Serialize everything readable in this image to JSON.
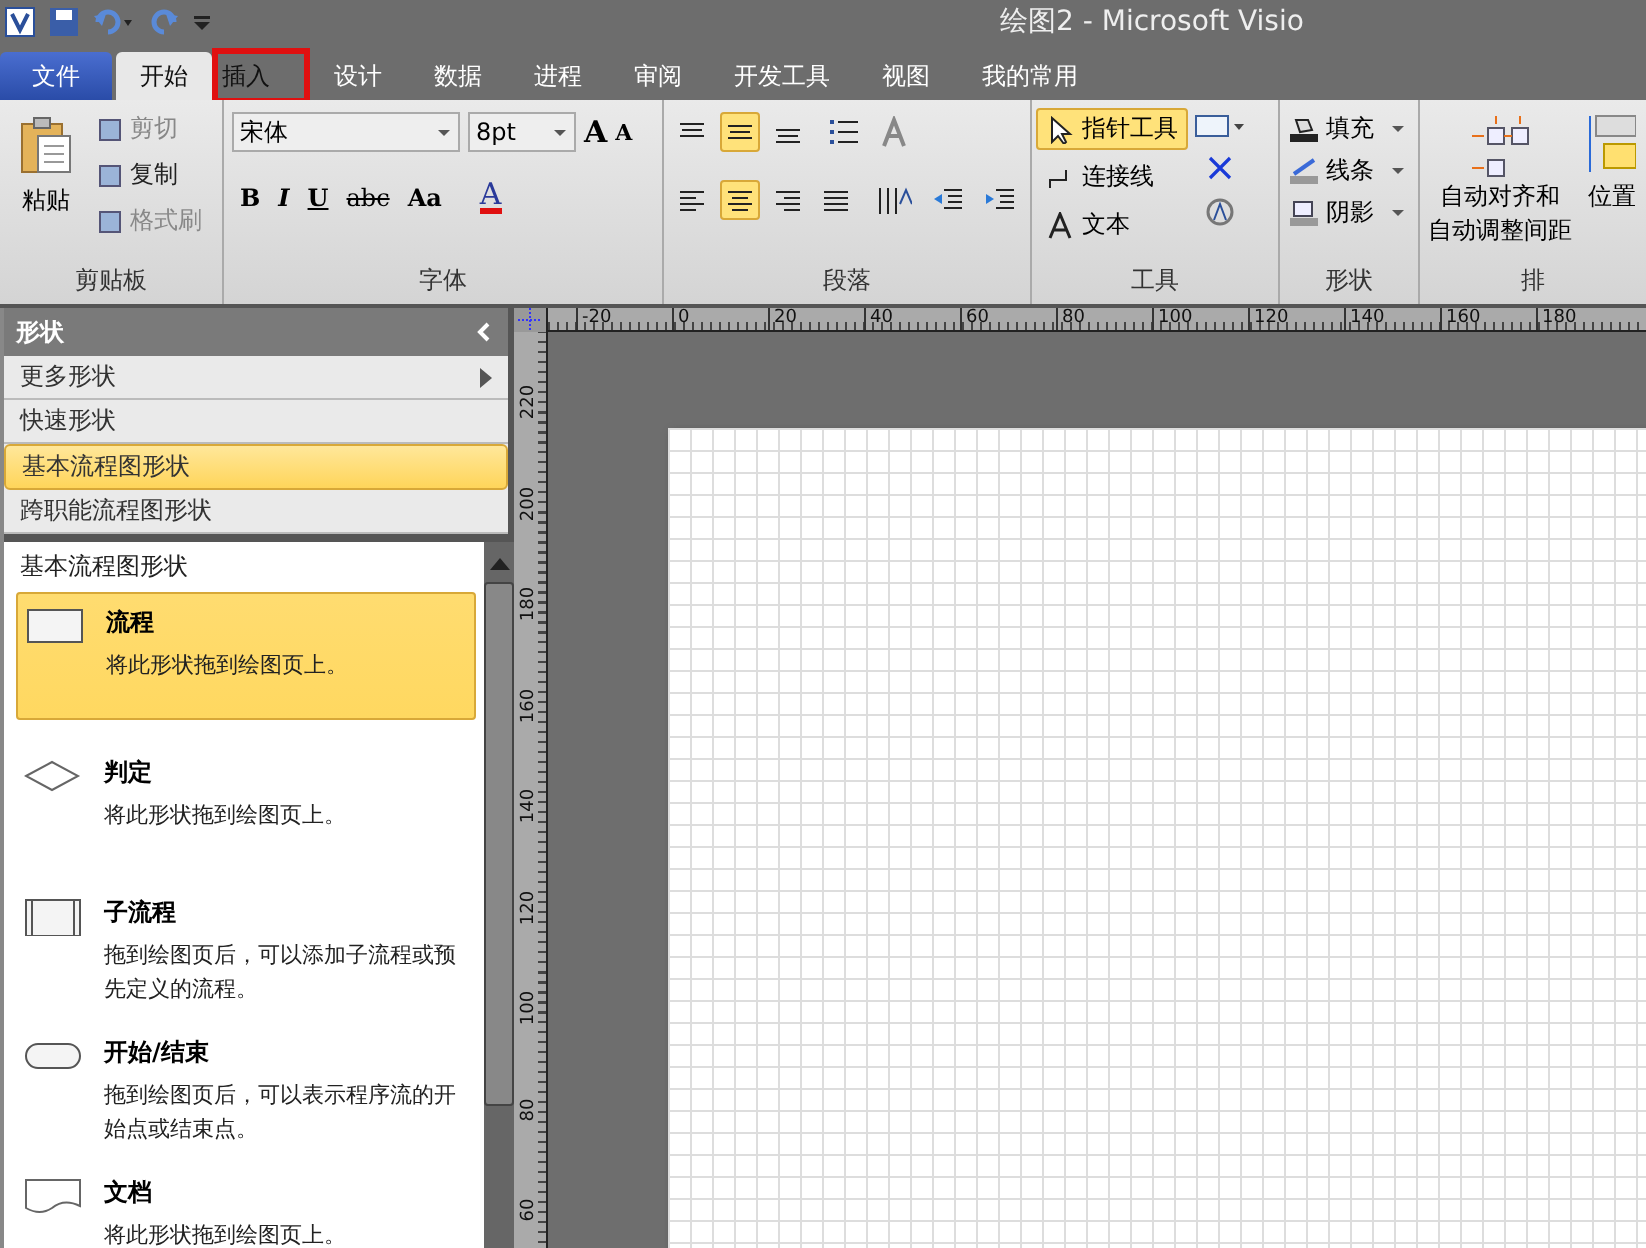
{
  "window": {
    "title": "绘图2 - Microsoft Visio"
  },
  "tabs": [
    {
      "label": "文件",
      "kind": "file",
      "selected": false,
      "highlighted": false
    },
    {
      "label": "开始",
      "kind": "tab",
      "selected": true,
      "highlighted": false
    },
    {
      "label": "插入",
      "kind": "tab",
      "selected": false,
      "highlighted": true
    },
    {
      "label": "设计",
      "kind": "tab",
      "selected": false,
      "highlighted": false
    },
    {
      "label": "数据",
      "kind": "tab",
      "selected": false,
      "highlighted": false
    },
    {
      "label": "进程",
      "kind": "tab",
      "selected": false,
      "highlighted": false
    },
    {
      "label": "审阅",
      "kind": "tab",
      "selected": false,
      "highlighted": false
    },
    {
      "label": "开发工具",
      "kind": "tab",
      "selected": false,
      "highlighted": false
    },
    {
      "label": "视图",
      "kind": "tab",
      "selected": false,
      "highlighted": false
    },
    {
      "label": "我的常用",
      "kind": "tab",
      "selected": false,
      "highlighted": false
    }
  ],
  "clipboard": {
    "label": "剪贴板",
    "paste": "粘贴",
    "items": [
      {
        "label": "剪切",
        "disabled": true
      },
      {
        "label": "复制",
        "disabled": false
      },
      {
        "label": "格式刷",
        "disabled": true
      }
    ]
  },
  "font": {
    "label": "字体",
    "family": "宋体",
    "size": "8pt",
    "size_buttons": [
      "A",
      "A"
    ],
    "format_buttons": [
      "B",
      "I",
      "U",
      "abc",
      "Aa"
    ],
    "font_color": "A"
  },
  "paragraph": {
    "label": "段落",
    "vertical_align": [
      {
        "selected": false
      },
      {
        "selected": true
      },
      {
        "selected": false
      }
    ],
    "horizontal_align": [
      {
        "selected": false
      },
      {
        "selected": true
      },
      {
        "selected": false
      },
      {
        "selected": false
      }
    ]
  },
  "tools": {
    "label": "工具",
    "items": [
      {
        "label": "指针工具",
        "selected": true
      },
      {
        "label": "连接线",
        "selected": false
      },
      {
        "label": "文本",
        "selected": false
      }
    ]
  },
  "shape_group": {
    "label": "形状",
    "items": [
      "填充",
      "线条",
      "阴影"
    ]
  },
  "arrange": {
    "label": "排",
    "auto_align": [
      "自动对齐和",
      "自动调整间距"
    ],
    "position": "位置"
  },
  "shapes_panel": {
    "title": "形状",
    "menu": [
      {
        "label": "更多形状",
        "selected": false,
        "submenu": true
      },
      {
        "label": "快速形状",
        "selected": false,
        "submenu": false
      },
      {
        "label": "基本流程图形状",
        "selected": true,
        "submenu": false
      },
      {
        "label": "跨职能流程图形状",
        "selected": false,
        "submenu": false
      }
    ],
    "stencil_title": "基本流程图形状",
    "shapes": [
      {
        "name": "流程",
        "kind": "process",
        "description": "将此形状拖到绘图页上。",
        "selected": true
      },
      {
        "name": "判定",
        "kind": "decision",
        "description": "将此形状拖到绘图页上。",
        "selected": false
      },
      {
        "name": "子流程",
        "kind": "subprocess",
        "description": "拖到绘图页后，可以添加子流程或预先定义的流程。",
        "selected": false
      },
      {
        "name": "开始/结束",
        "kind": "terminator",
        "description": "拖到绘图页后，可以表示程序流的开始点或结束点。",
        "selected": false
      },
      {
        "name": "文档",
        "kind": "document",
        "description": "将此形状拖到绘图页上。",
        "selected": false
      }
    ]
  },
  "rulers": {
    "horizontal": [
      "-20",
      "0",
      "20",
      "40",
      "60",
      "80",
      "100",
      "120",
      "140",
      "160",
      "180"
    ],
    "vertical": [
      "220",
      "200",
      "180",
      "160",
      "140",
      "120",
      "100",
      "80",
      "60"
    ]
  }
}
